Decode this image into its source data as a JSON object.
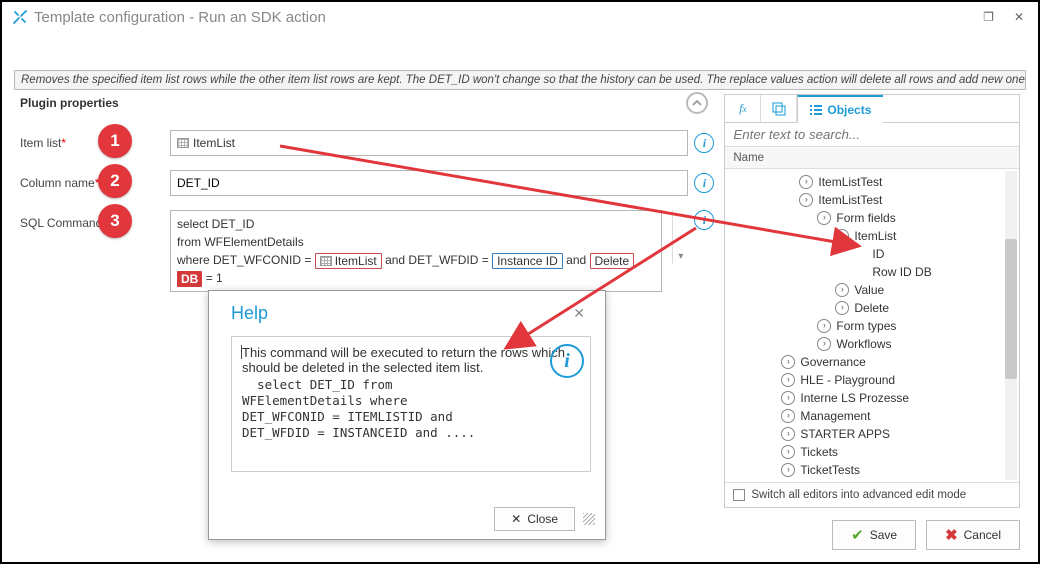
{
  "window": {
    "title": "Template configuration - Run an SDK action",
    "description": "Removes the specified item list rows while the other item list rows are kept. The DET_ID won't change so that the history can be used. The replace values action will delete all rows and add new ones"
  },
  "properties": {
    "section_title": "Plugin properties",
    "labels": {
      "item_list": "Item list",
      "column_name": "Column name",
      "sql_command": "SQL Command"
    },
    "badges": {
      "b1": "1",
      "b2": "2",
      "b3": "3"
    },
    "item_list_value": "ItemList",
    "column_name_value": "DET_ID",
    "sql": {
      "line1": "select DET_ID",
      "line2": "from WFElementDetails",
      "line3_a": "where DET_WFCONID = ",
      "chip_itemlist": "ItemList",
      "line3_b": " and DET_WFDID = ",
      "chip_instance": "Instance ID",
      "line3_c": " and ",
      "chip_delete": "Delete",
      "chip_db": "DB",
      "line3_d": " = 1"
    }
  },
  "help": {
    "title": "Help",
    "text": "This command will be executed to return the rows which should be deleted in the selected item list.",
    "code": "  select DET_ID from\nWFElementDetails where\nDET_WFCONID = ITEMLISTID and\nDET_WFDID = INSTANCEID and ....",
    "close": "Close"
  },
  "right": {
    "tab_objects": "Objects",
    "search_placeholder": "Enter text to search...",
    "col_name": "Name",
    "tree": [
      {
        "indent": 3,
        "label": "ItemListTest"
      },
      {
        "indent": 3,
        "label": "ItemListTest"
      },
      {
        "indent": 4,
        "label": "Form fields"
      },
      {
        "indent": 5,
        "label": "ItemList"
      },
      {
        "indent": 6,
        "label": "ID",
        "plain": true
      },
      {
        "indent": 6,
        "label": "Row ID DB",
        "plain": true
      },
      {
        "indent": 5,
        "label": "Value"
      },
      {
        "indent": 5,
        "label": "Delete"
      },
      {
        "indent": 4,
        "label": "Form types"
      },
      {
        "indent": 4,
        "label": "Workflows"
      },
      {
        "indent": 2,
        "label": "Governance"
      },
      {
        "indent": 2,
        "label": "HLE - Playground"
      },
      {
        "indent": 2,
        "label": "Interne LS Prozesse"
      },
      {
        "indent": 2,
        "label": "Management"
      },
      {
        "indent": 2,
        "label": "STARTER APPS"
      },
      {
        "indent": 2,
        "label": "Tickets"
      },
      {
        "indent": 2,
        "label": "TicketTests"
      }
    ],
    "advanced": "Switch all editors into advanced edit mode"
  },
  "buttons": {
    "save": "Save",
    "cancel": "Cancel"
  }
}
